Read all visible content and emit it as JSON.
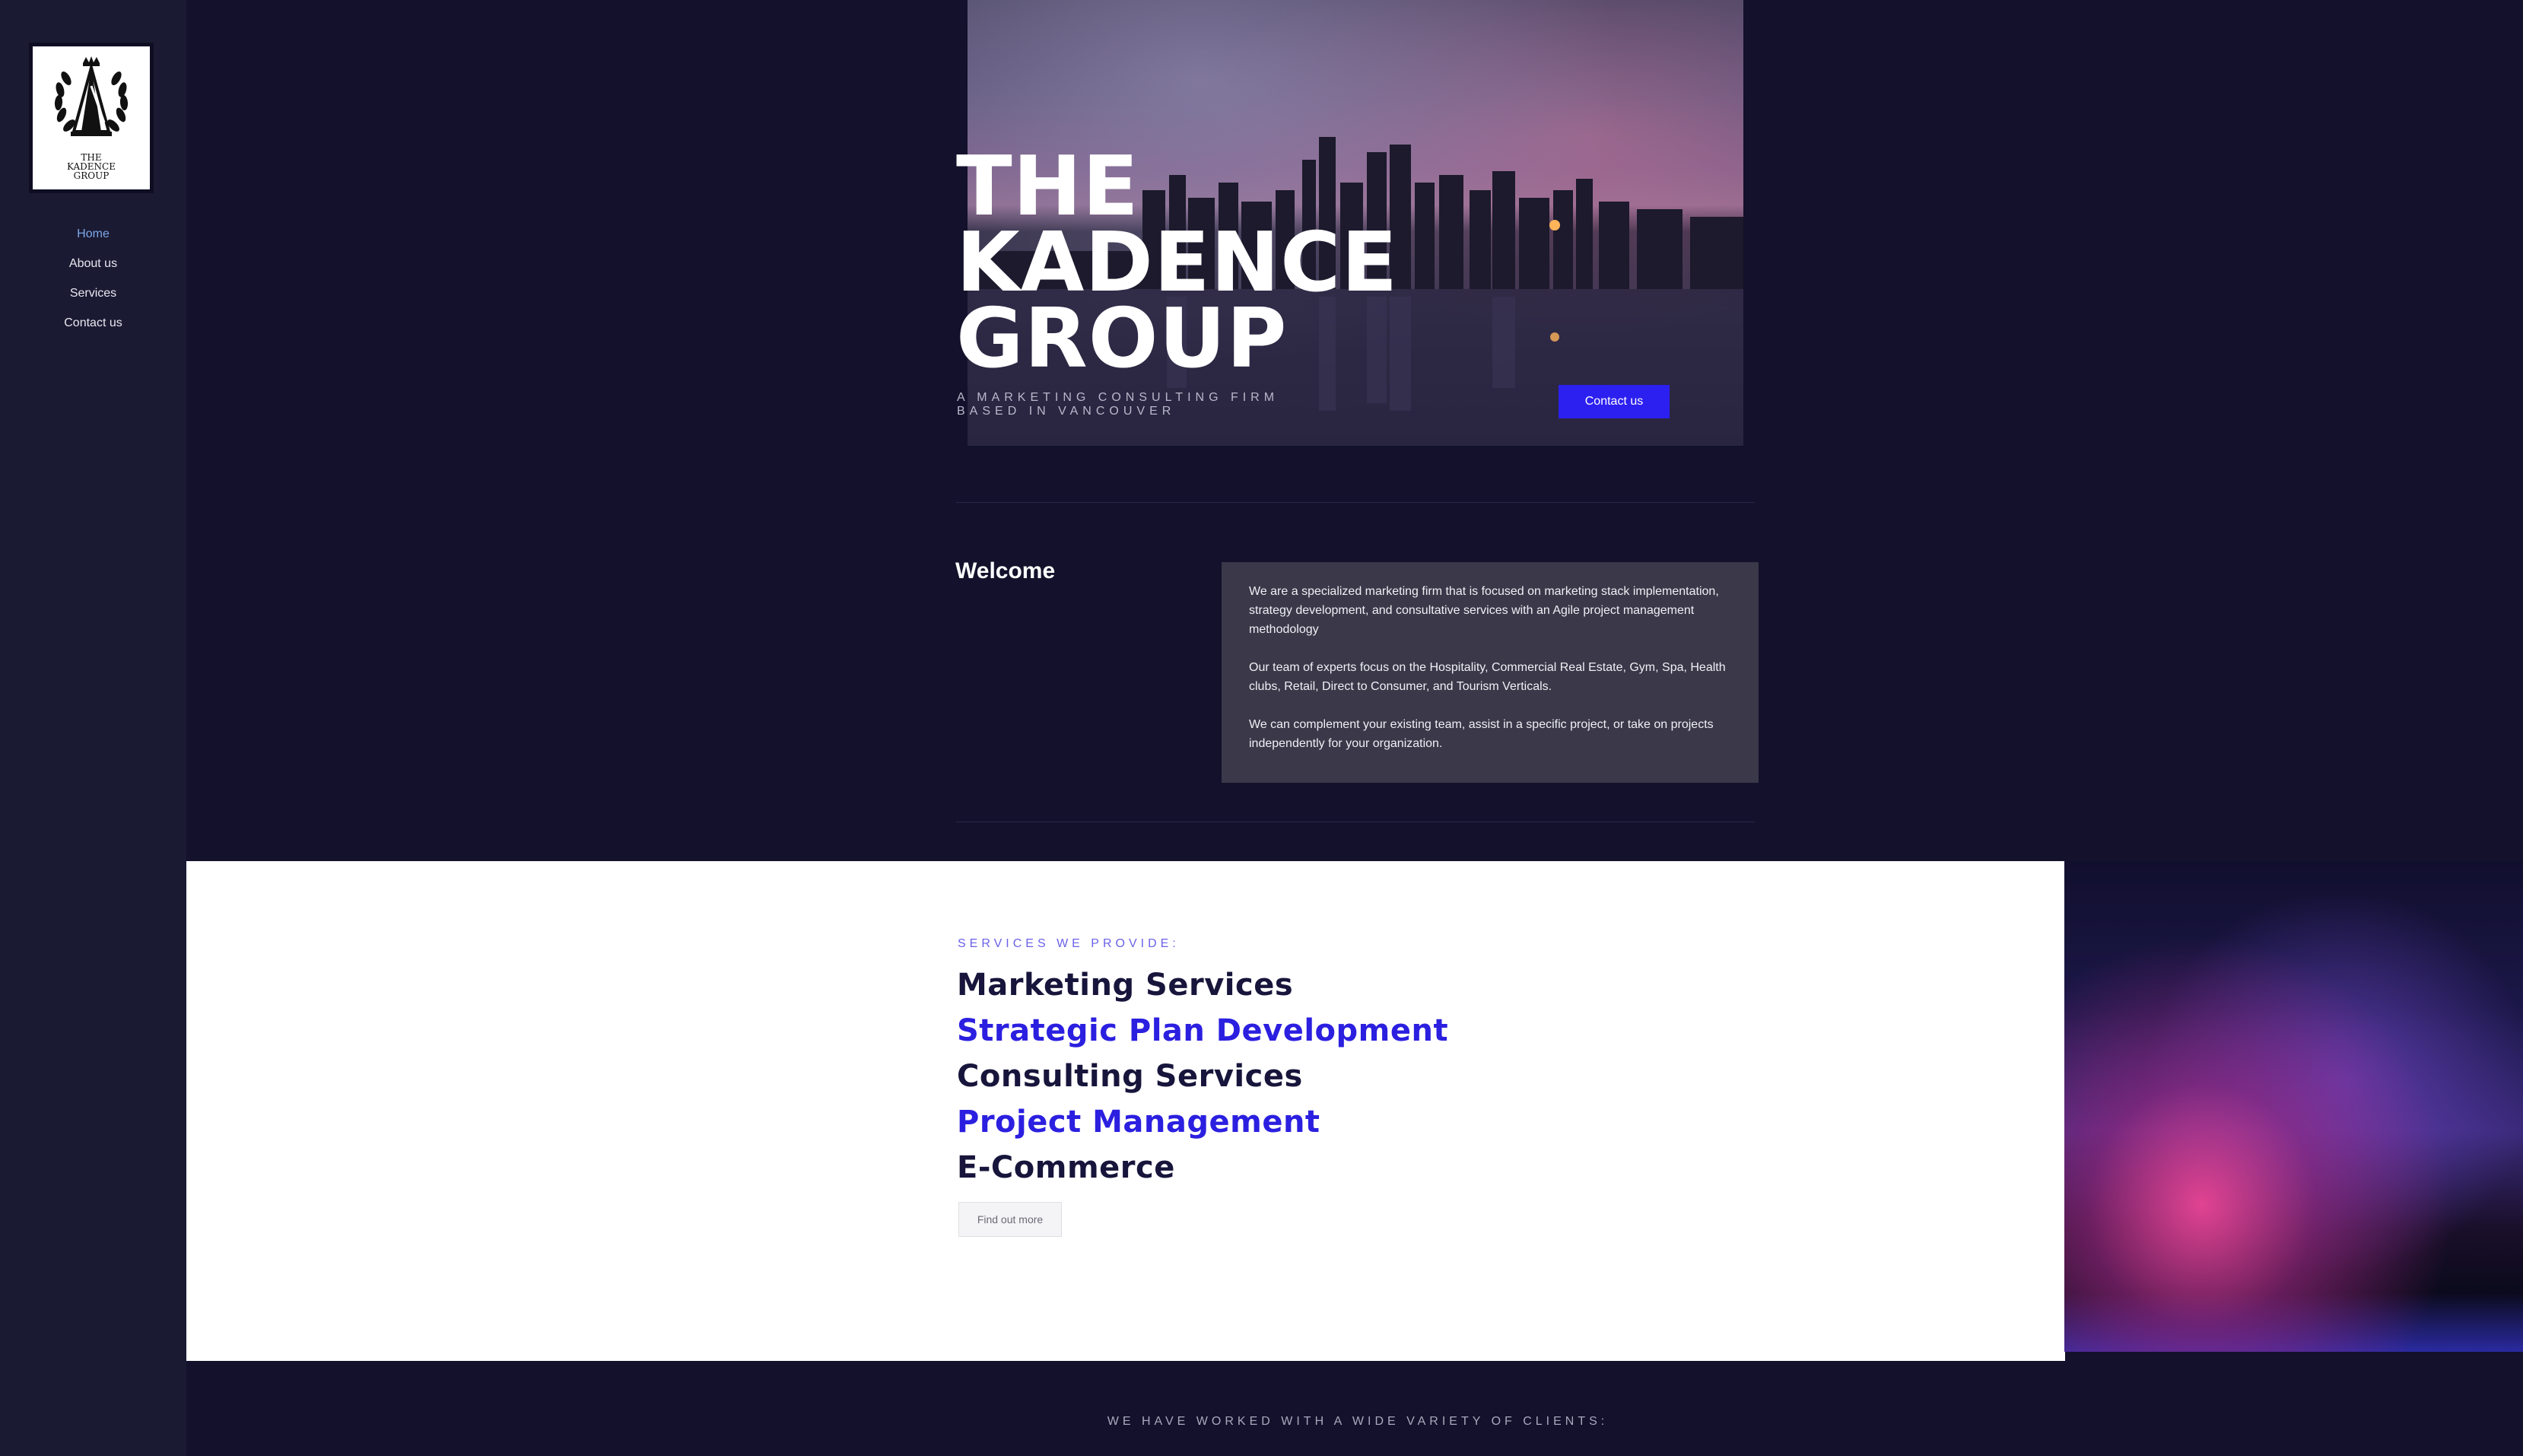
{
  "sidebar": {
    "logo_lines": [
      "THE",
      "KADENCE",
      "GROUP"
    ],
    "items": [
      {
        "label": "Home",
        "active": true
      },
      {
        "label": "About us"
      },
      {
        "label": "Services"
      },
      {
        "label": "Contact us"
      }
    ]
  },
  "hero": {
    "title_lines": [
      "THE",
      "KADENCE",
      "GROUP"
    ],
    "subtitle": "A MARKETING CONSULTING FIRM BASED IN VANCOUVER",
    "cta_label": "Contact us"
  },
  "welcome": {
    "title": "Welcome",
    "paragraphs": [
      "We are a specialized marketing firm that is focused on marketing stack implementation, strategy development, and consultative services with an Agile project management methodology",
      "Our team of experts focus on the Hospitality, Commercial Real Estate, Gym, Spa, Health clubs, Retail, Direct to Consumer, and Tourism Verticals.",
      "We can complement your existing team, assist in a specific project, or take on projects independently for your organization."
    ]
  },
  "services": {
    "kicker": "SERVICES WE PROVIDE:",
    "items": [
      "Marketing Services",
      "Strategic Plan Development",
      "Consulting Services",
      "Project Management",
      "E-Commerce"
    ],
    "button_label": "Find out more"
  },
  "clients": {
    "kicker": "WE HAVE WORKED WITH A WIDE VARIETY OF CLIENTS:"
  },
  "colors": {
    "background": "#13112b",
    "sidebar": "#1b1a33",
    "accent": "#2c20f0",
    "nav_active": "#7ba8e6",
    "service_dark": "#17153b",
    "service_accent": "#2b1fe0"
  }
}
